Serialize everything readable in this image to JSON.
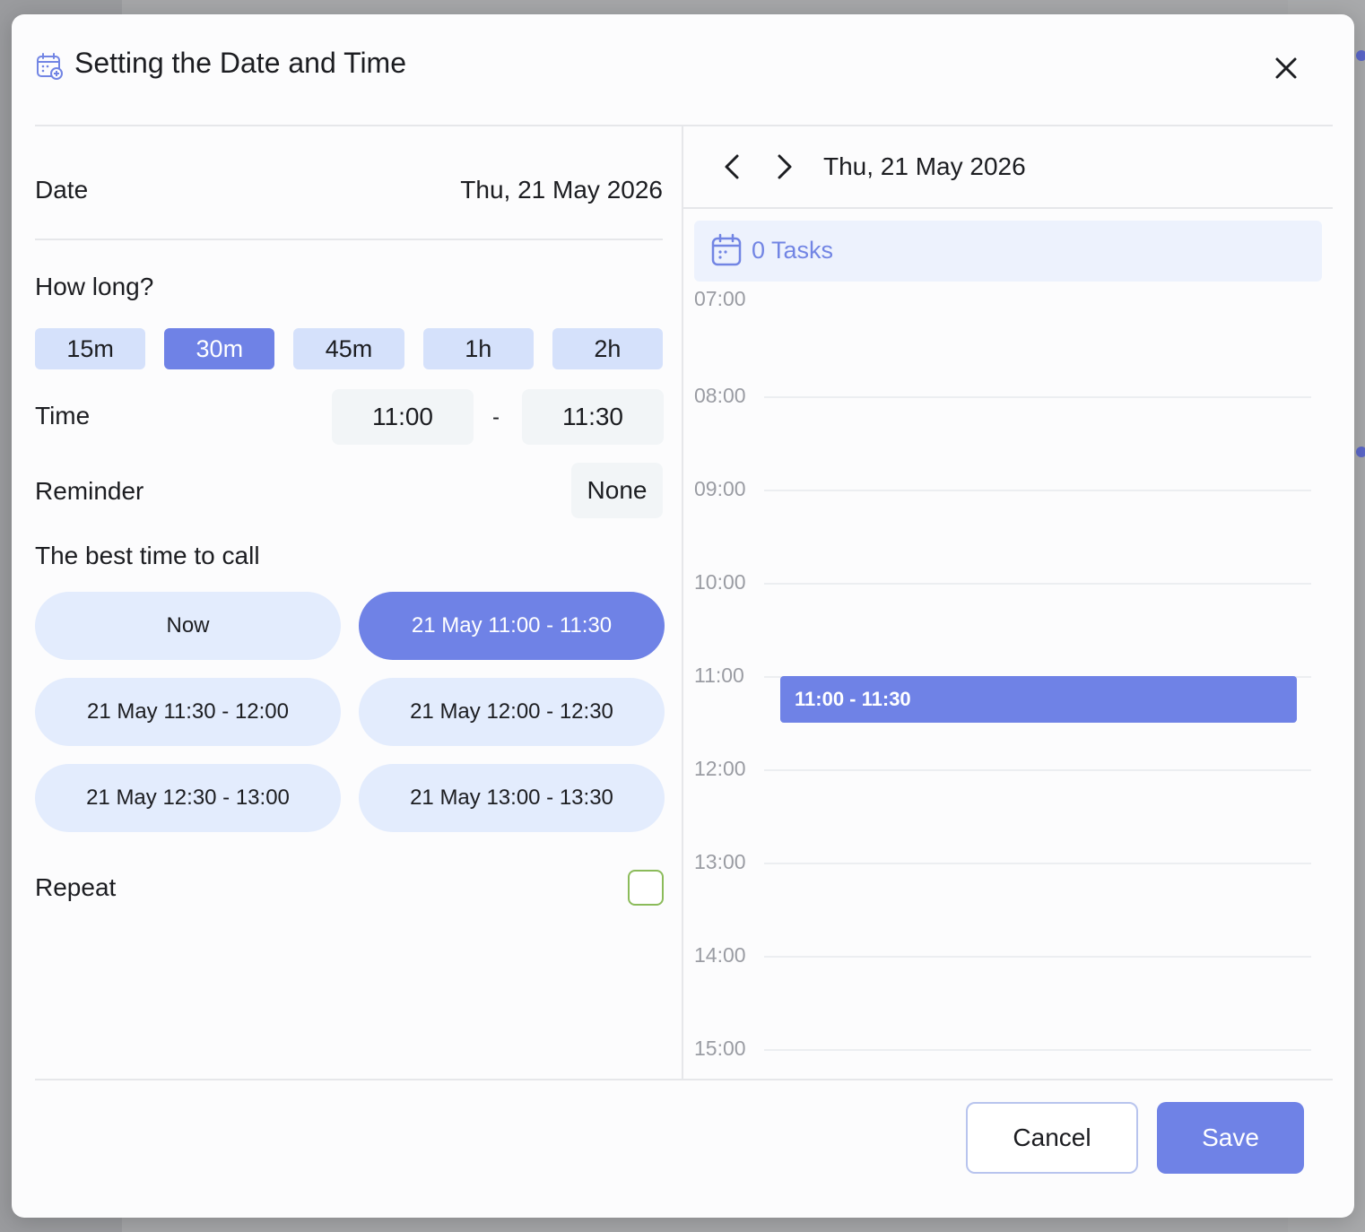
{
  "modal": {
    "title": "Setting the Date and Time",
    "header_icon": "calendar-clock-icon",
    "close_icon": "close-icon"
  },
  "form": {
    "date_label": "Date",
    "date_value": "Thu, 21 May 2026",
    "duration_label": "How long?",
    "durations": [
      {
        "label": "15m",
        "selected": false
      },
      {
        "label": "30m",
        "selected": true
      },
      {
        "label": "45m",
        "selected": false
      },
      {
        "label": "1h",
        "selected": false
      },
      {
        "label": "2h",
        "selected": false
      }
    ],
    "time_label": "Time",
    "time_start": "11:00",
    "time_separator": "-",
    "time_end": "11:30",
    "reminder_label": "Reminder",
    "reminder_value": "None",
    "best_time_label": "The best time to call",
    "slots": [
      {
        "label": "Now",
        "selected": false
      },
      {
        "label": "21 May 11:00 - 11:30",
        "selected": true
      },
      {
        "label": "21 May 11:30 - 12:00",
        "selected": false
      },
      {
        "label": "21 May 12:00 - 12:30",
        "selected": false
      },
      {
        "label": "21 May 12:30 - 13:00",
        "selected": false
      },
      {
        "label": "21 May 13:00 - 13:30",
        "selected": false
      }
    ],
    "repeat_label": "Repeat",
    "repeat_checked": false
  },
  "calendar": {
    "prev_icon": "chevron-left-icon",
    "next_icon": "chevron-right-icon",
    "date": "Thu, 21 May 2026",
    "tasks_icon": "calendar-icon",
    "tasks_label": "0 Tasks",
    "hours": [
      "07:00",
      "08:00",
      "09:00",
      "10:00",
      "11:00",
      "12:00",
      "13:00",
      "14:00",
      "15:00"
    ],
    "event": {
      "label": "11:00 - 11:30",
      "start": "11:00",
      "end": "11:30"
    }
  },
  "footer": {
    "cancel_label": "Cancel",
    "save_label": "Save"
  },
  "colors": {
    "accent": "#6f82e6",
    "chip_bg": "#d5e1fb",
    "slot_bg": "#e3ecfd",
    "checkbox_border": "#8bbb5a"
  }
}
